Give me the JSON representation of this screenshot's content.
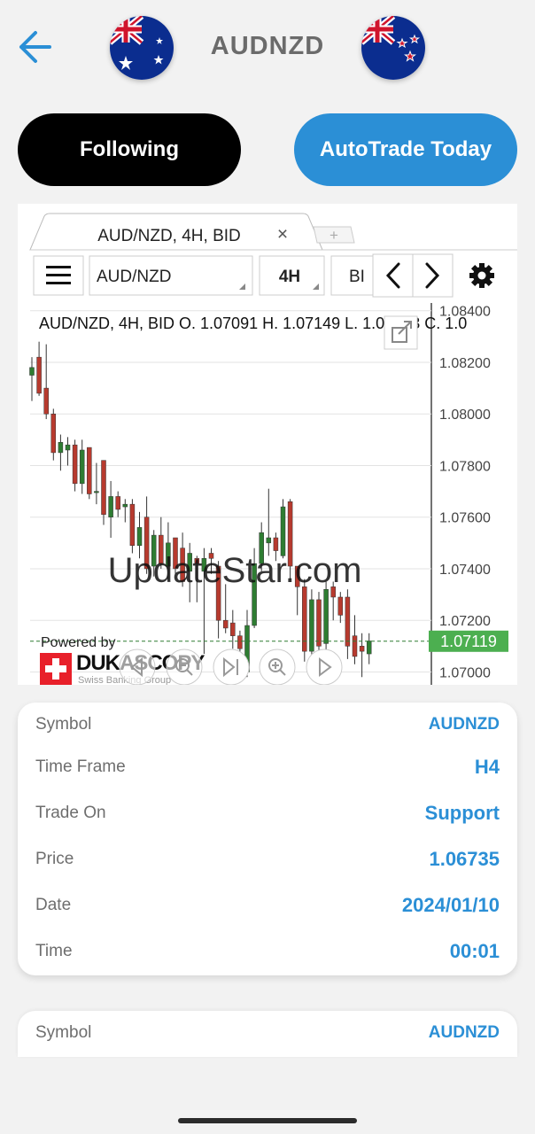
{
  "header": {
    "title": "AUDNZD",
    "base_flag": "australia-flag",
    "quote_flag": "new-zealand-flag"
  },
  "buttons": {
    "following": "Following",
    "autotrade": "AutoTrade Today"
  },
  "colors": {
    "accent": "#2b8fd6",
    "black": "#000000",
    "bull": "#2e7d32",
    "bear": "#b73a2e",
    "last_price_bg": "#4caf50"
  },
  "chart_widget": {
    "tab_label": "AUD/NZD, 4H, BID",
    "tab_close": "×",
    "tab_add": "+",
    "symbol_select": "AUD/NZD",
    "timeframe_select": "4H",
    "side_select": "BI",
    "prev_icon": "chevron-left-icon",
    "next_icon": "chevron-right-icon",
    "settings_icon": "gear-icon",
    "legend": "AUD/NZD, 4H, BID    O. 1.07091  H. 1.07149  L. 1.07033  C. 1.0",
    "watermark": "UpdateStar.com",
    "powered_by": "Powered by",
    "brand": "DUKASCOPY",
    "brand_sub": "Swiss Banking Group",
    "last_price_label": "1.07119"
  },
  "chart_data": {
    "type": "candlestick",
    "title": "AUD/NZD, 4H, BID",
    "ylim": [
      1.0695,
      1.0843
    ],
    "y_ticks": [
      "1.08400",
      "1.08200",
      "1.08000",
      "1.07800",
      "1.07600",
      "1.07400",
      "1.07200",
      "1.07000"
    ],
    "y_tick_values": [
      1.084,
      1.082,
      1.08,
      1.078,
      1.076,
      1.074,
      1.072,
      1.07
    ],
    "last_price": 1.07119,
    "ohlc": [
      [
        1.0815,
        1.0822,
        1.0805,
        1.0818
      ],
      [
        1.0822,
        1.0828,
        1.0807,
        1.0808
      ],
      [
        1.081,
        1.0827,
        1.0798,
        1.08
      ],
      [
        1.08,
        1.0802,
        1.0782,
        1.0785
      ],
      [
        1.0785,
        1.0792,
        1.0778,
        1.0789
      ],
      [
        1.0786,
        1.0791,
        1.078,
        1.0788
      ],
      [
        1.0788,
        1.079,
        1.077,
        1.0773
      ],
      [
        1.0773,
        1.079,
        1.0769,
        1.0786
      ],
      [
        1.0787,
        1.0787,
        1.0767,
        1.0769
      ],
      [
        1.077,
        1.0781,
        1.0765,
        1.077
      ],
      [
        1.0782,
        1.0782,
        1.0757,
        1.0761
      ],
      [
        1.076,
        1.0774,
        1.0752,
        1.0768
      ],
      [
        1.0768,
        1.077,
        1.076,
        1.0763
      ],
      [
        1.0764,
        1.0767,
        1.0758,
        1.0765
      ],
      [
        1.0765,
        1.0767,
        1.0746,
        1.0749
      ],
      [
        1.0749,
        1.0762,
        1.0744,
        1.0756
      ],
      [
        1.076,
        1.0768,
        1.0738,
        1.074
      ],
      [
        1.0741,
        1.0755,
        1.0737,
        1.0753
      ],
      [
        1.0753,
        1.076,
        1.074,
        1.0742
      ],
      [
        1.0741,
        1.0758,
        1.0736,
        1.075
      ],
      [
        1.0752,
        1.0752,
        1.0738,
        1.074
      ],
      [
        1.0748,
        1.0754,
        1.0733,
        1.0735
      ],
      [
        1.0739,
        1.075,
        1.0727,
        1.0746
      ],
      [
        1.0744,
        1.0745,
        1.0727,
        1.0742
      ],
      [
        1.0739,
        1.0748,
        1.0707,
        1.0744
      ],
      [
        1.0746,
        1.0748,
        1.0738,
        1.0744
      ],
      [
        1.0741,
        1.0743,
        1.0713,
        1.072
      ],
      [
        1.072,
        1.0734,
        1.0715,
        1.0717
      ],
      [
        1.0719,
        1.0724,
        1.0709,
        1.0714
      ],
      [
        1.0714,
        1.0716,
        1.0702,
        1.0709
      ],
      [
        1.07,
        1.0724,
        1.0698,
        1.0718
      ],
      [
        1.0718,
        1.0748,
        1.0717,
        1.0742
      ],
      [
        1.0742,
        1.0758,
        1.0739,
        1.0754
      ],
      [
        1.075,
        1.0771,
        1.0745,
        1.0752
      ],
      [
        1.0752,
        1.0754,
        1.0743,
        1.0747
      ],
      [
        1.0745,
        1.0767,
        1.0744,
        1.0764
      ],
      [
        1.0766,
        1.0767,
        1.0736,
        1.0741
      ],
      [
        1.0741,
        1.0741,
        1.0722,
        1.0733
      ],
      [
        1.0733,
        1.0736,
        1.0704,
        1.0708
      ],
      [
        1.0708,
        1.0732,
        1.0705,
        1.0728
      ],
      [
        1.0728,
        1.0731,
        1.0708,
        1.071
      ],
      [
        1.0711,
        1.0735,
        1.0708,
        1.0732
      ],
      [
        1.0733,
        1.0735,
        1.072,
        1.0729
      ],
      [
        1.0729,
        1.0731,
        1.0719,
        1.0722
      ],
      [
        1.0729,
        1.0732,
        1.0705,
        1.071
      ],
      [
        1.0714,
        1.0722,
        1.0703,
        1.0706
      ],
      [
        1.071,
        1.0715,
        1.0698,
        1.0708
      ],
      [
        1.0707,
        1.0715,
        1.0703,
        1.0712
      ]
    ]
  },
  "signal_card": {
    "rows": [
      {
        "label": "Symbol",
        "value": "AUDNZD"
      },
      {
        "label": "Time Frame",
        "value": "H4"
      },
      {
        "label": "Trade On",
        "value": "Support"
      },
      {
        "label": "Price",
        "value": "1.06735"
      },
      {
        "label": "Date",
        "value": "2024/01/10"
      },
      {
        "label": "Time",
        "value": "00:01"
      }
    ]
  },
  "signal_card_2": {
    "rows": [
      {
        "label": "Symbol",
        "value": "AUDNZD"
      }
    ]
  }
}
